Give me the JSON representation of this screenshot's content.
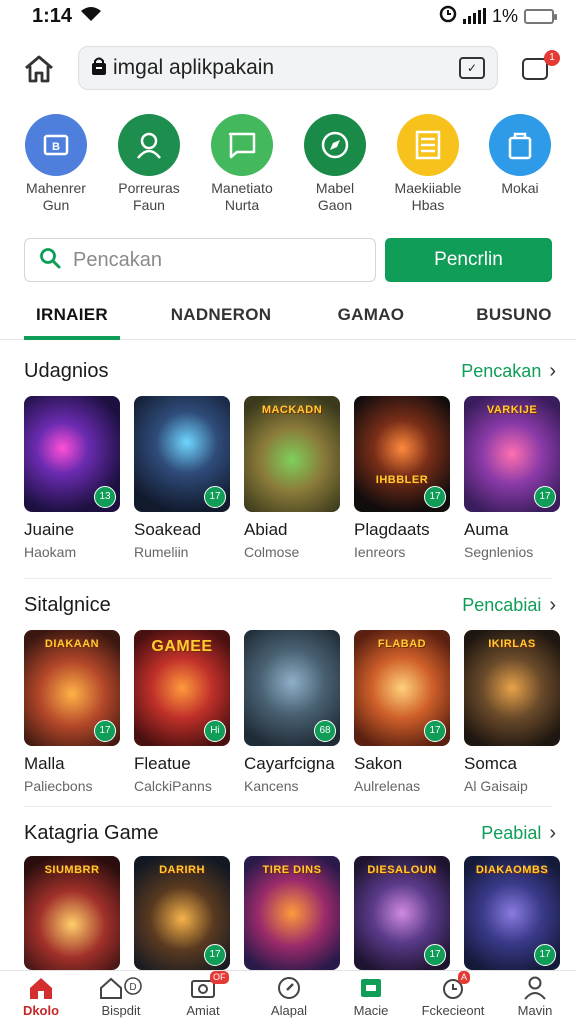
{
  "status": {
    "time": "1:14",
    "battery": "1%",
    "battery_level": 1
  },
  "urlbar": {
    "text": "imgal aplikpakain"
  },
  "shortcuts": [
    {
      "label": "Mahenrer\nGun",
      "color": "#4f7fdc",
      "icon": "square-b-icon"
    },
    {
      "label": "Porreuras\nFaun",
      "color": "#1e8e4e",
      "icon": "person-icon"
    },
    {
      "label": "Manetiato\nNurta",
      "color": "#43b85c",
      "icon": "chat-icon"
    },
    {
      "label": "Mabel\nGaon",
      "color": "#1a8a48",
      "icon": "compass-icon"
    },
    {
      "label": "Maekiiable\nHbas",
      "color": "#f6c21b",
      "icon": "list-icon"
    },
    {
      "label": "Mokai",
      "color": "#2e9be9",
      "icon": "bag-icon"
    }
  ],
  "search": {
    "placeholder": "Pencakan",
    "button": "Pencrlin"
  },
  "tabs": [
    "IRNAIER",
    "NADNERON",
    "GAMAO",
    "BUSUNO"
  ],
  "sections": [
    {
      "title": "Udagnios",
      "more": "Pencakan",
      "games": [
        {
          "name": "Juaine",
          "sub": "Haokam",
          "art_text": "",
          "badge": "13"
        },
        {
          "name": "Soakead",
          "sub": "Rumeliin",
          "art_text": "",
          "badge": "17"
        },
        {
          "name": "Abiad",
          "sub": "Colmose",
          "art_text": "MACKADN",
          "badge": ""
        },
        {
          "name": "Plagdaats",
          "sub": "Ienreors",
          "art_text": "IHBBLER",
          "badge": "17"
        },
        {
          "name": "Auma",
          "sub": "Segnlenios",
          "art_text": "VARKIJE",
          "badge": "17"
        }
      ]
    },
    {
      "title": "Sitalgnice",
      "more": "Pencabiai",
      "games": [
        {
          "name": "Malla",
          "sub": "Paliecbons",
          "art_text": "DIAKAAN",
          "badge": "17"
        },
        {
          "name": "Fleatue",
          "sub": "CalckiPanns",
          "art_text": "GAMEE",
          "badge": "Hi"
        },
        {
          "name": "Cayarfcigna",
          "sub": "Kancens",
          "art_text": "",
          "badge": "68"
        },
        {
          "name": "Sakon",
          "sub": "Aulrelenas",
          "art_text": "FLABAD",
          "badge": "17"
        },
        {
          "name": "Somca",
          "sub": "Al Gaisaip",
          "art_text": "IKIRLAS",
          "badge": ""
        }
      ]
    },
    {
      "title": "Katagria Game",
      "more": "Peabial",
      "games": [
        {
          "name": "",
          "sub": "",
          "art_text": "SIUMBRR",
          "badge": ""
        },
        {
          "name": "",
          "sub": "",
          "art_text": "DARIRH",
          "badge": "17"
        },
        {
          "name": "",
          "sub": "",
          "art_text": "TIRE DINS",
          "badge": ""
        },
        {
          "name": "",
          "sub": "",
          "art_text": "DIESALOUN",
          "badge": "17"
        },
        {
          "name": "",
          "sub": "",
          "art_text": "DIAKAOMBS",
          "badge": "17"
        }
      ]
    }
  ],
  "bottomnav": [
    {
      "label": "Dkolo",
      "icon": "home-icon",
      "active": true,
      "badge": ""
    },
    {
      "label": "Bispdit",
      "icon": "home-outline-icon",
      "active": false,
      "badge": ""
    },
    {
      "label": "Amiat",
      "icon": "media-icon",
      "active": false,
      "badge": "OF"
    },
    {
      "label": "Alapal",
      "icon": "compass-icon",
      "active": false,
      "badge": ""
    },
    {
      "label": "Macie",
      "icon": "store-icon",
      "active": false,
      "badge": ""
    },
    {
      "label": "Fckecieont",
      "icon": "alarm-icon",
      "active": false,
      "badge": "A"
    },
    {
      "label": "Mavin",
      "icon": "person-icon",
      "active": false,
      "badge": ""
    }
  ]
}
